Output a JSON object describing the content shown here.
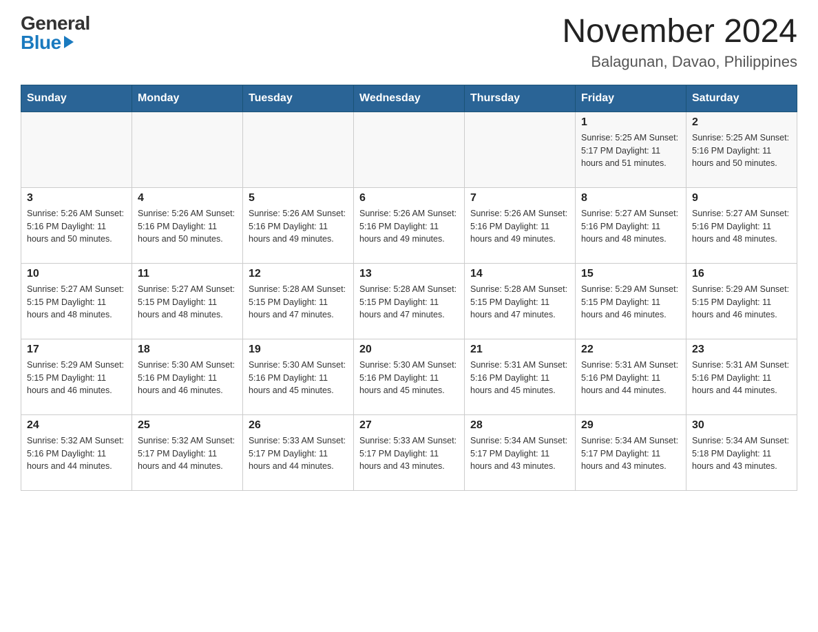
{
  "logo": {
    "general": "General",
    "blue": "Blue"
  },
  "title": "November 2024",
  "location": "Balagunan, Davao, Philippines",
  "weekdays": [
    "Sunday",
    "Monday",
    "Tuesday",
    "Wednesday",
    "Thursday",
    "Friday",
    "Saturday"
  ],
  "weeks": [
    [
      {
        "day": "",
        "info": ""
      },
      {
        "day": "",
        "info": ""
      },
      {
        "day": "",
        "info": ""
      },
      {
        "day": "",
        "info": ""
      },
      {
        "day": "",
        "info": ""
      },
      {
        "day": "1",
        "info": "Sunrise: 5:25 AM\nSunset: 5:17 PM\nDaylight: 11 hours and 51 minutes."
      },
      {
        "day": "2",
        "info": "Sunrise: 5:25 AM\nSunset: 5:16 PM\nDaylight: 11 hours and 50 minutes."
      }
    ],
    [
      {
        "day": "3",
        "info": "Sunrise: 5:26 AM\nSunset: 5:16 PM\nDaylight: 11 hours and 50 minutes."
      },
      {
        "day": "4",
        "info": "Sunrise: 5:26 AM\nSunset: 5:16 PM\nDaylight: 11 hours and 50 minutes."
      },
      {
        "day": "5",
        "info": "Sunrise: 5:26 AM\nSunset: 5:16 PM\nDaylight: 11 hours and 49 minutes."
      },
      {
        "day": "6",
        "info": "Sunrise: 5:26 AM\nSunset: 5:16 PM\nDaylight: 11 hours and 49 minutes."
      },
      {
        "day": "7",
        "info": "Sunrise: 5:26 AM\nSunset: 5:16 PM\nDaylight: 11 hours and 49 minutes."
      },
      {
        "day": "8",
        "info": "Sunrise: 5:27 AM\nSunset: 5:16 PM\nDaylight: 11 hours and 48 minutes."
      },
      {
        "day": "9",
        "info": "Sunrise: 5:27 AM\nSunset: 5:16 PM\nDaylight: 11 hours and 48 minutes."
      }
    ],
    [
      {
        "day": "10",
        "info": "Sunrise: 5:27 AM\nSunset: 5:15 PM\nDaylight: 11 hours and 48 minutes."
      },
      {
        "day": "11",
        "info": "Sunrise: 5:27 AM\nSunset: 5:15 PM\nDaylight: 11 hours and 48 minutes."
      },
      {
        "day": "12",
        "info": "Sunrise: 5:28 AM\nSunset: 5:15 PM\nDaylight: 11 hours and 47 minutes."
      },
      {
        "day": "13",
        "info": "Sunrise: 5:28 AM\nSunset: 5:15 PM\nDaylight: 11 hours and 47 minutes."
      },
      {
        "day": "14",
        "info": "Sunrise: 5:28 AM\nSunset: 5:15 PM\nDaylight: 11 hours and 47 minutes."
      },
      {
        "day": "15",
        "info": "Sunrise: 5:29 AM\nSunset: 5:15 PM\nDaylight: 11 hours and 46 minutes."
      },
      {
        "day": "16",
        "info": "Sunrise: 5:29 AM\nSunset: 5:15 PM\nDaylight: 11 hours and 46 minutes."
      }
    ],
    [
      {
        "day": "17",
        "info": "Sunrise: 5:29 AM\nSunset: 5:15 PM\nDaylight: 11 hours and 46 minutes."
      },
      {
        "day": "18",
        "info": "Sunrise: 5:30 AM\nSunset: 5:16 PM\nDaylight: 11 hours and 46 minutes."
      },
      {
        "day": "19",
        "info": "Sunrise: 5:30 AM\nSunset: 5:16 PM\nDaylight: 11 hours and 45 minutes."
      },
      {
        "day": "20",
        "info": "Sunrise: 5:30 AM\nSunset: 5:16 PM\nDaylight: 11 hours and 45 minutes."
      },
      {
        "day": "21",
        "info": "Sunrise: 5:31 AM\nSunset: 5:16 PM\nDaylight: 11 hours and 45 minutes."
      },
      {
        "day": "22",
        "info": "Sunrise: 5:31 AM\nSunset: 5:16 PM\nDaylight: 11 hours and 44 minutes."
      },
      {
        "day": "23",
        "info": "Sunrise: 5:31 AM\nSunset: 5:16 PM\nDaylight: 11 hours and 44 minutes."
      }
    ],
    [
      {
        "day": "24",
        "info": "Sunrise: 5:32 AM\nSunset: 5:16 PM\nDaylight: 11 hours and 44 minutes."
      },
      {
        "day": "25",
        "info": "Sunrise: 5:32 AM\nSunset: 5:17 PM\nDaylight: 11 hours and 44 minutes."
      },
      {
        "day": "26",
        "info": "Sunrise: 5:33 AM\nSunset: 5:17 PM\nDaylight: 11 hours and 44 minutes."
      },
      {
        "day": "27",
        "info": "Sunrise: 5:33 AM\nSunset: 5:17 PM\nDaylight: 11 hours and 43 minutes."
      },
      {
        "day": "28",
        "info": "Sunrise: 5:34 AM\nSunset: 5:17 PM\nDaylight: 11 hours and 43 minutes."
      },
      {
        "day": "29",
        "info": "Sunrise: 5:34 AM\nSunset: 5:17 PM\nDaylight: 11 hours and 43 minutes."
      },
      {
        "day": "30",
        "info": "Sunrise: 5:34 AM\nSunset: 5:18 PM\nDaylight: 11 hours and 43 minutes."
      }
    ]
  ]
}
